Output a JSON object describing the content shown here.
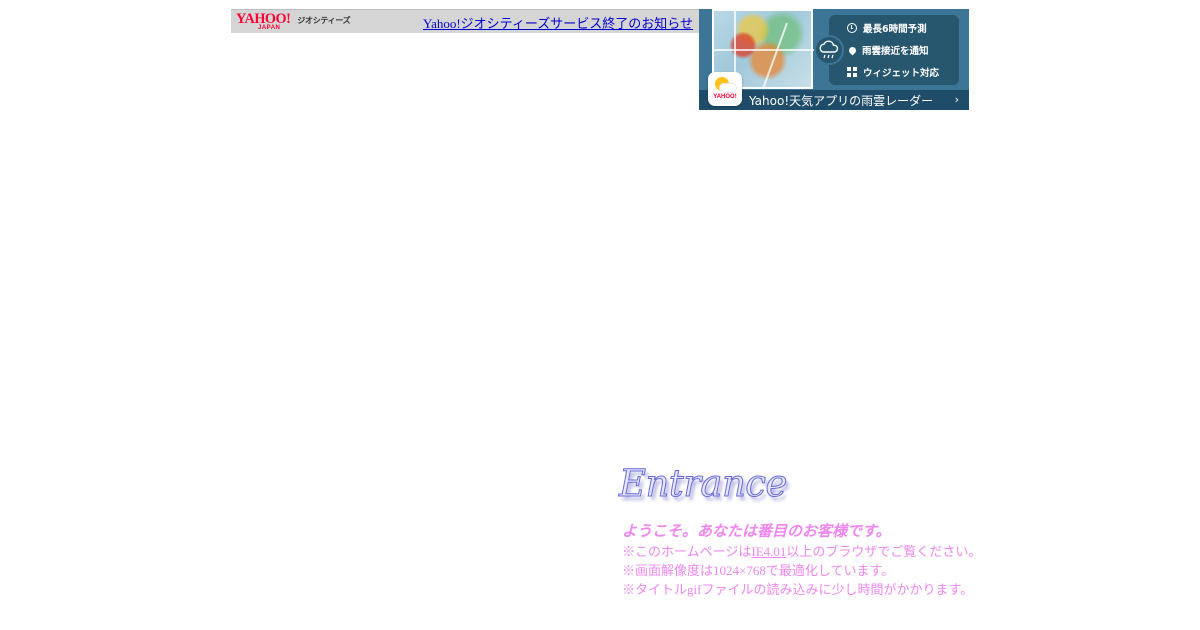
{
  "geocities_bar": {
    "logo_text": "YAHOO!",
    "logo_sub": "JAPAN",
    "service_text": "ジオシティーズ",
    "notice_link": "Yahoo!ジオシティーズサービス終了のお知らせ"
  },
  "ad_banner": {
    "features": [
      {
        "icon": "clock-icon",
        "label": "最長6時間予測"
      },
      {
        "icon": "pin-icon",
        "label": "雨雲接近を通知"
      },
      {
        "icon": "widget-icon",
        "label": "ウィジェット対応"
      }
    ],
    "app_icon_label": "YAHOO!",
    "cta_text": "Yahoo!天気アプリの雨雲レーダー",
    "cta_chevron": "›",
    "colors": {
      "banner_bg": "#3c7596",
      "panel_bg": "#27566f"
    }
  },
  "entrance": {
    "title": "Entrance",
    "welcome": "ようこそ。あなたは番目のお客様です。",
    "note1_prefix": "※このホームページは",
    "note1_link": "IE4.01",
    "note1_suffix": "以上のブラウザでご覧ください。",
    "note2": "※画面解像度は1024×768で最適化しています。",
    "note3": "※タイトルgifファイルの読み込みに少し時間がかかります。",
    "text_color": "#ee88ee"
  }
}
